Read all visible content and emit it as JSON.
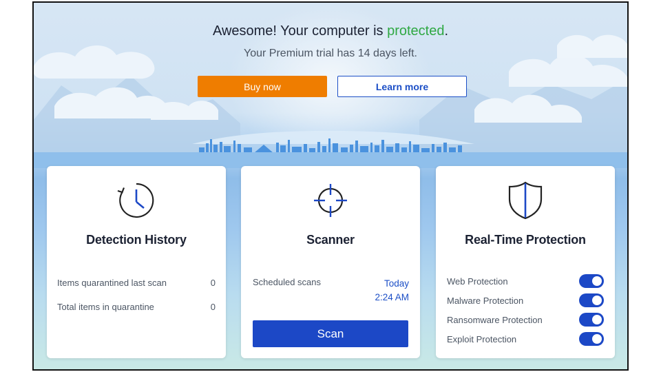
{
  "hero": {
    "headline_prefix": "Awesome! Your computer is ",
    "headline_status": "protected",
    "headline_suffix": ".",
    "trial_text": "Your Premium trial has 14 days left.",
    "buy_label": "Buy now",
    "learn_label": "Learn more"
  },
  "detection": {
    "title": "Detection History",
    "rows": [
      {
        "label": "Items quarantined last scan",
        "value": "0"
      },
      {
        "label": "Total items in quarantine",
        "value": "0"
      }
    ]
  },
  "scanner": {
    "title": "Scanner",
    "scheduled_label": "Scheduled scans",
    "scheduled_day": "Today",
    "scheduled_time": "2:24 AM",
    "scan_label": "Scan"
  },
  "realtime": {
    "title": "Real-Time Protection",
    "items": [
      {
        "label": "Web Protection",
        "enabled": true
      },
      {
        "label": "Malware Protection",
        "enabled": true
      },
      {
        "label": "Ransomware Protection",
        "enabled": true
      },
      {
        "label": "Exploit Protection",
        "enabled": true
      }
    ]
  },
  "colors": {
    "accent": "#1c48c6",
    "buy": "#ef7d00",
    "status_ok": "#2fa843"
  },
  "icons": [
    "clock-history-icon",
    "crosshair-icon",
    "shield-icon"
  ]
}
